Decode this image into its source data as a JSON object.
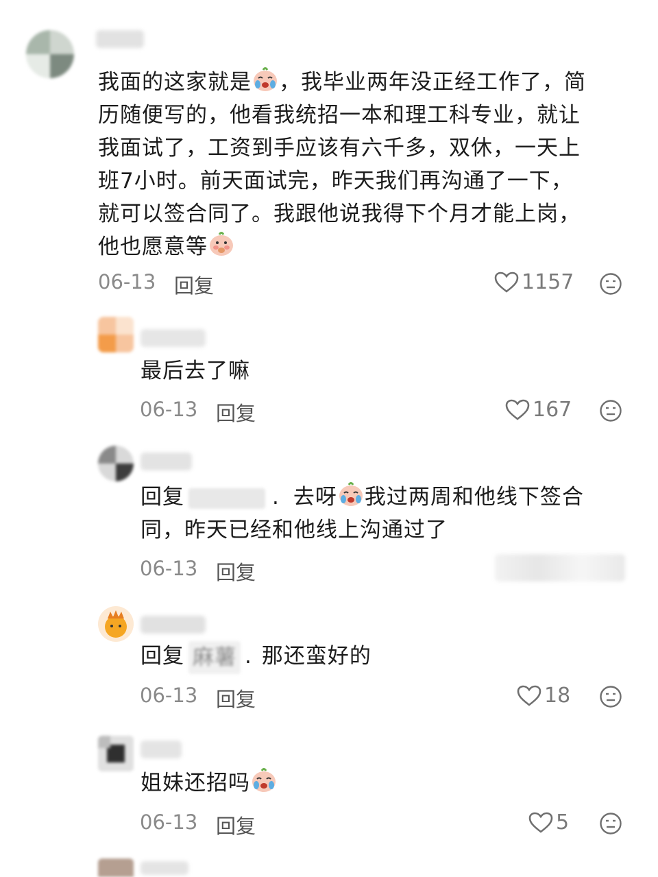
{
  "comments": [
    {
      "text_a": "我面的这家就是",
      "text_b": "，我毕业两年没正经工作了，简",
      "text_c": "历随便写的，他看我统招一本和理工科专业，就让",
      "text_d": "我面试了，工资到手应该有六千多，双休，一天上",
      "text_e": "班7小时。前天面试完，昨天我们再沟通了一下，",
      "text_f": "就可以签合同了。我跟他说我得下个月才能上岗，",
      "text_g": "他也愿意等",
      "date": "06-13",
      "reply": "回复",
      "likes": "1157",
      "emoji_1": "crying-face",
      "emoji_2": "shy-face"
    },
    {
      "text": "最后去了嘛",
      "date": "06-13",
      "reply": "回复",
      "likes": "167"
    },
    {
      "prefix": "回复",
      "sep": ".",
      "text_a": "去呀",
      "text_b": "我过两周和他线下签合",
      "text_c": "同，昨天已经和他线上沟通过了",
      "date": "06-13",
      "reply": "回复",
      "emoji": "crying-face"
    },
    {
      "prefix": "回复",
      "mention": "麻薯",
      "sep": ".",
      "text": "那还蛮好的",
      "date": "06-13",
      "reply": "回复",
      "likes": "18"
    },
    {
      "text": "姐妹还招吗",
      "date": "06-13",
      "reply": "回复",
      "likes": "5",
      "emoji": "crying-face"
    }
  ],
  "colors": {
    "text": "#1c1c1c",
    "meta": "#8a8a8a",
    "icon": "#6f6f6f"
  }
}
